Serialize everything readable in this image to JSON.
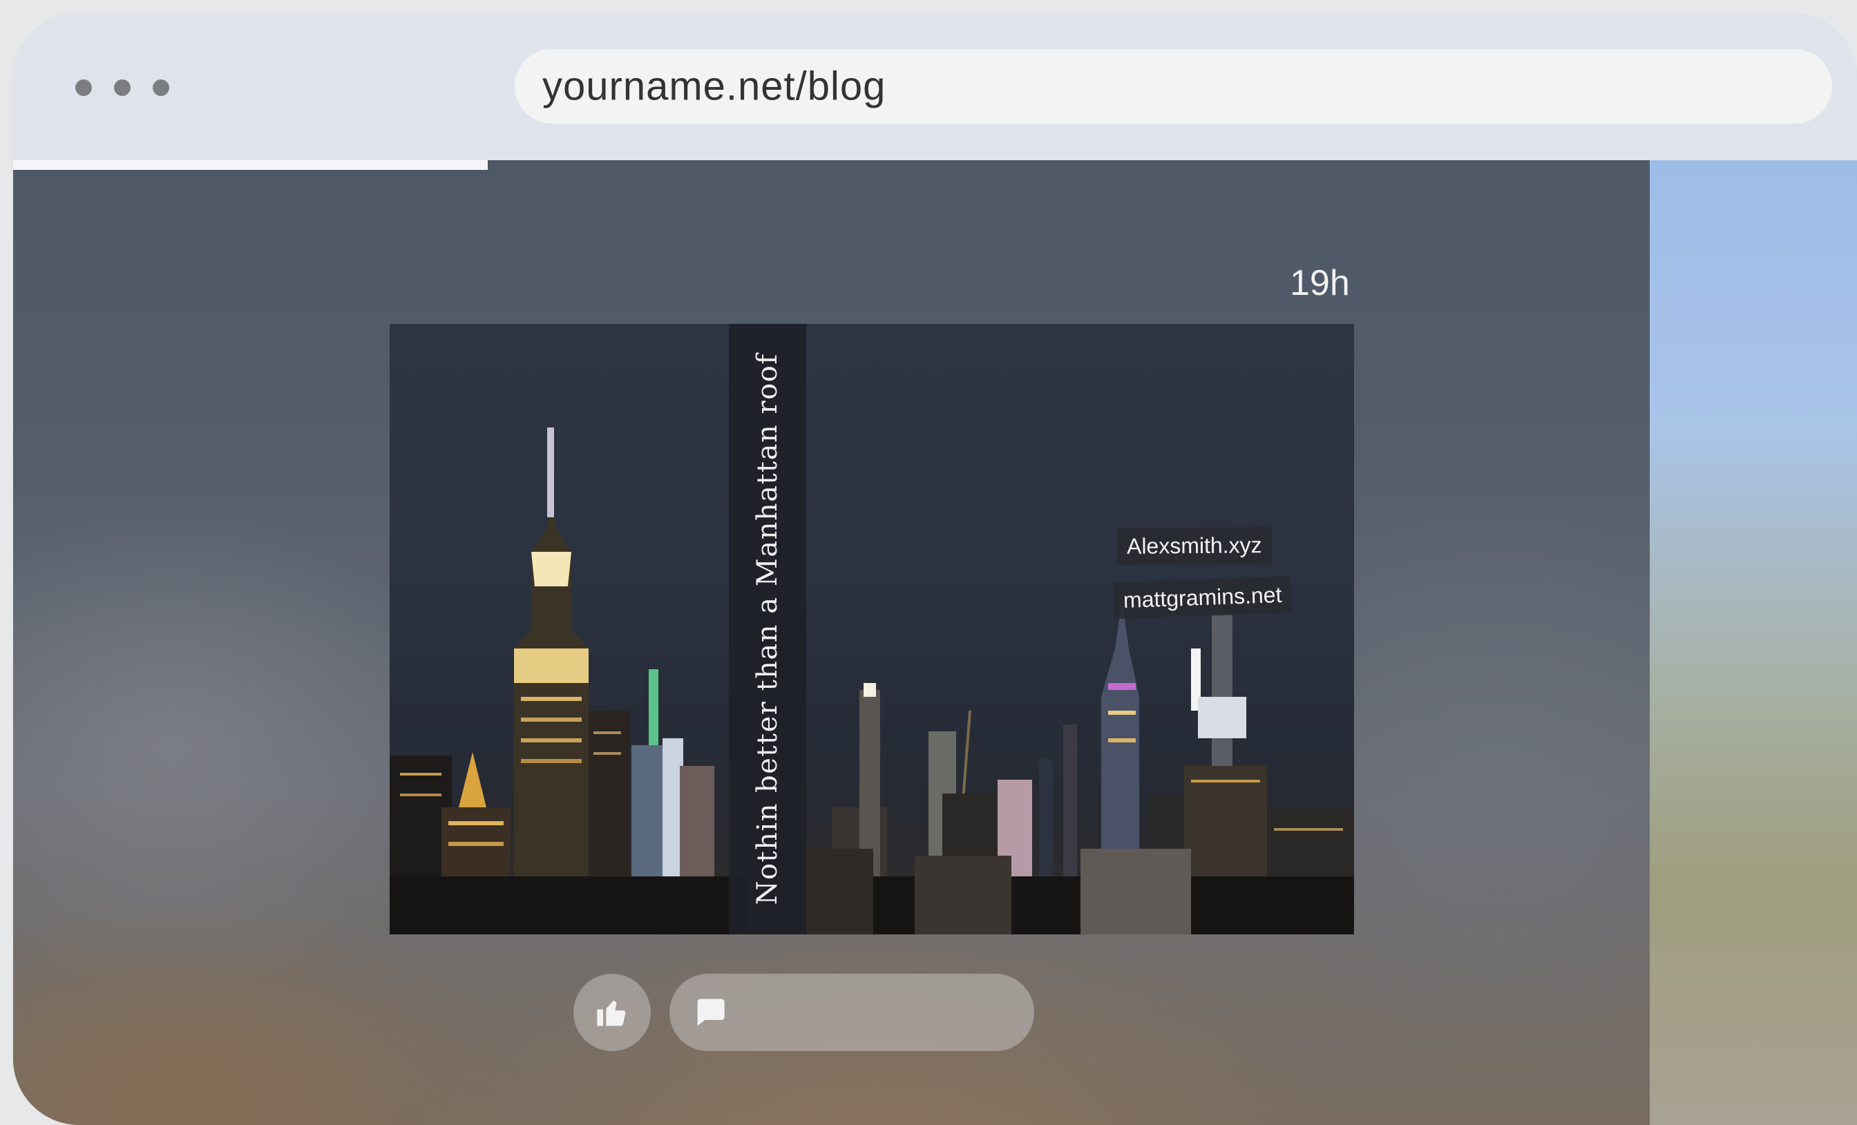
{
  "browser": {
    "window_controls": [
      "dot",
      "dot",
      "dot"
    ],
    "url": "yourname.net/blog"
  },
  "progress": {
    "percent": 29
  },
  "post": {
    "timestamp": "19h",
    "photo": {
      "caption": "Nothin better than a Manhattan roof",
      "tags": [
        "Alexsmith.xyz",
        "mattgramins.net"
      ]
    },
    "actions": {
      "like_icon": "thumbs-up-icon",
      "comment_icon": "comment-icon"
    }
  },
  "colors": {
    "titlebar": "#dfe4ec",
    "urlbar": "#f3f3f3",
    "progress": "#f4f5f6",
    "side_panel_sky": "#a9c4e7"
  }
}
